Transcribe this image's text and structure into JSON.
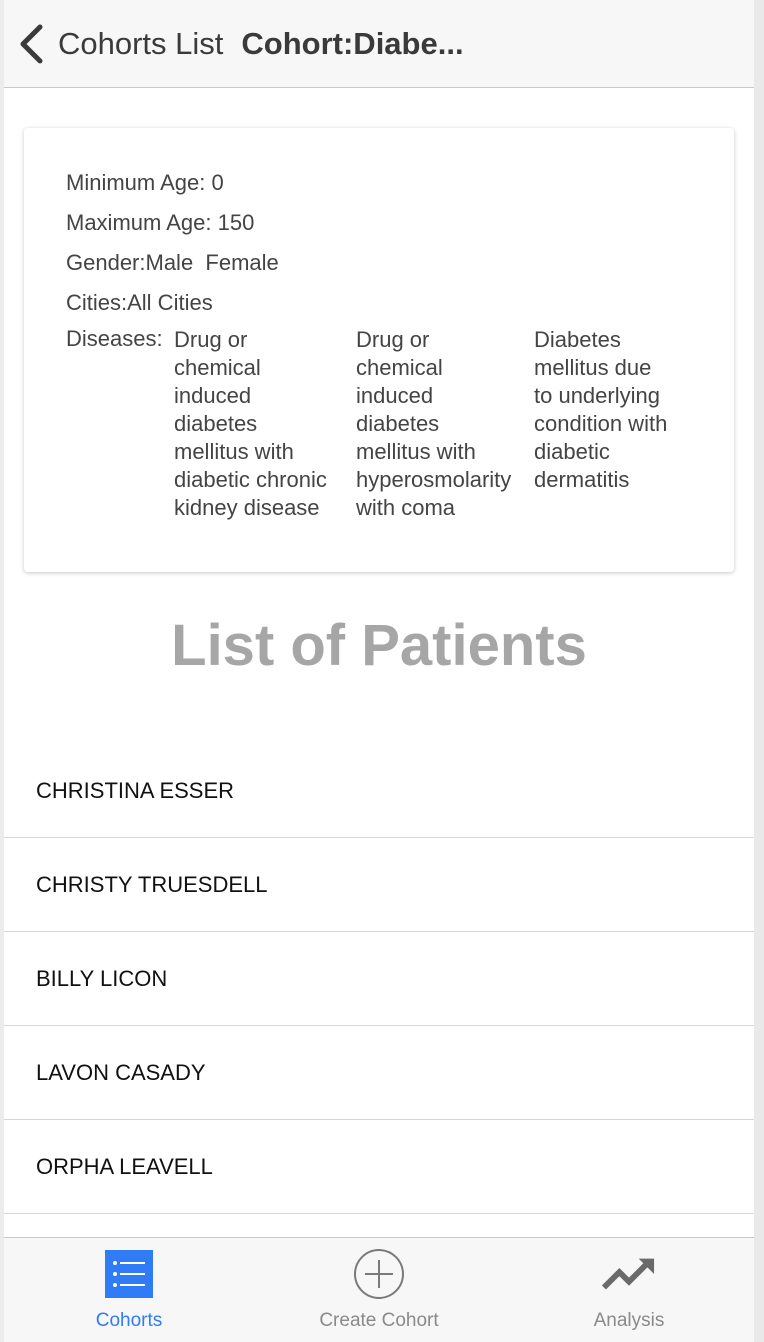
{
  "nav": {
    "back_label": "Cohorts List",
    "title": "Cohort:Diabe..."
  },
  "criteria": {
    "min_age_label": "Minimum Age:",
    "min_age": "0",
    "max_age_label": "Maximum Age:",
    "max_age": "150",
    "gender_label": "Gender:",
    "gender": "Male  Female",
    "cities_label": "Cities:",
    "cities": "All Cities",
    "diseases_label": "Diseases:",
    "diseases": [
      [
        "Drug or",
        "chemical",
        "induced",
        "diabetes",
        "mellitus with",
        "diabetic chronic",
        "kidney disease"
      ],
      [
        "Drug or",
        "chemical",
        "induced",
        "diabetes",
        "mellitus with",
        "hyperosmolarity",
        "with coma"
      ],
      [
        "Diabetes",
        "mellitus due",
        "to underlying",
        "condition with",
        "diabetic",
        "dermatitis"
      ]
    ]
  },
  "patients_heading": "List of Patients",
  "patients": [
    "CHRISTINA ESSER",
    "CHRISTY TRUESDELL",
    "BILLY LICON",
    "LAVON CASADY",
    "ORPHA LEAVELL"
  ],
  "tabbar": {
    "tabs": [
      {
        "label": "Cohorts",
        "icon": "list-icon",
        "active": true
      },
      {
        "label": "Create Cohort",
        "icon": "plus-circle-icon",
        "active": false
      },
      {
        "label": "Analysis",
        "icon": "trend-up-icon",
        "active": false
      }
    ]
  },
  "colors": {
    "accent": "#2f7cf6",
    "heading_gray": "#a6a6a6"
  }
}
